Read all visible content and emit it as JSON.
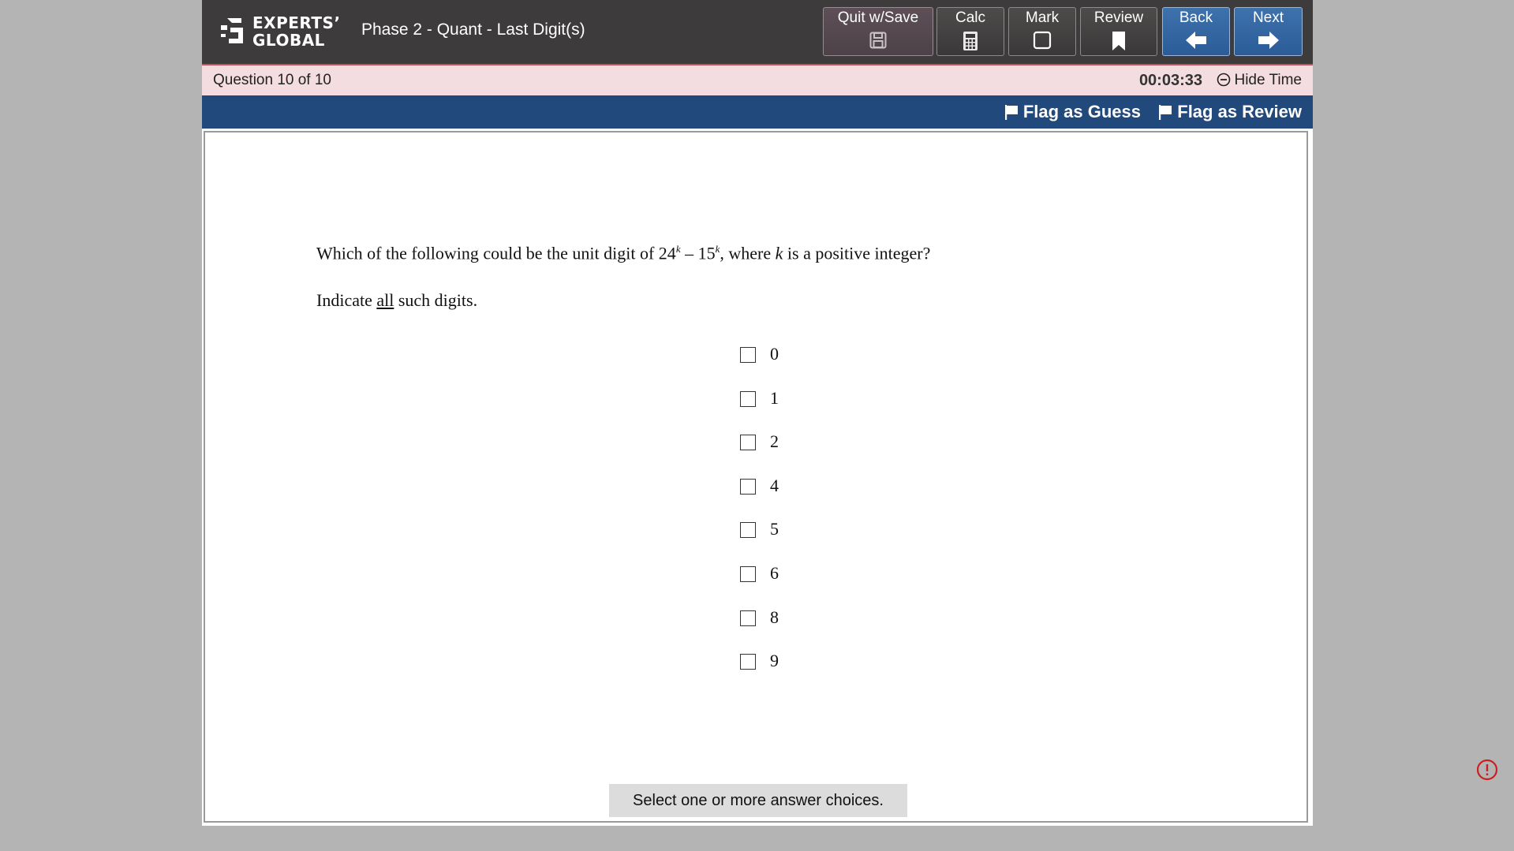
{
  "brand": {
    "line1": "EXPERTS’",
    "line2": "GLOBAL"
  },
  "exam_title": "Phase 2 - Quant - Last Digit(s)",
  "toolbar": {
    "quit_label": "Quit w/Save",
    "calc_label": "Calc",
    "mark_label": "Mark",
    "review_label": "Review",
    "back_label": "Back",
    "next_label": "Next"
  },
  "status": {
    "question_label": "Question",
    "question_position": "10 of 10",
    "timer": "00:03:33",
    "hide_time_label": "Hide Time"
  },
  "flags": {
    "guess_label": "Flag as Guess",
    "review_label": "Flag as Review"
  },
  "question": {
    "prefix": "Which of the following could be the unit digit of 24",
    "exp1": "k",
    "mid": " – 15",
    "exp2": "k",
    "middle": ", where ",
    "var": "k",
    "suffix": " is a positive integer?",
    "instruction_pre": "Indicate ",
    "instruction_emph": "all",
    "instruction_post": " such digits."
  },
  "choices": [
    "0",
    "1",
    "2",
    "4",
    "5",
    "6",
    "8",
    "9"
  ],
  "select_message": "Select one or more answer choices.",
  "colors": {
    "topbar": "#3d3b3b",
    "statusbar": "#f4dde1",
    "flagbar": "#21497c",
    "nav_blue": "#2b5c97",
    "alert": "#cc1f1f"
  }
}
